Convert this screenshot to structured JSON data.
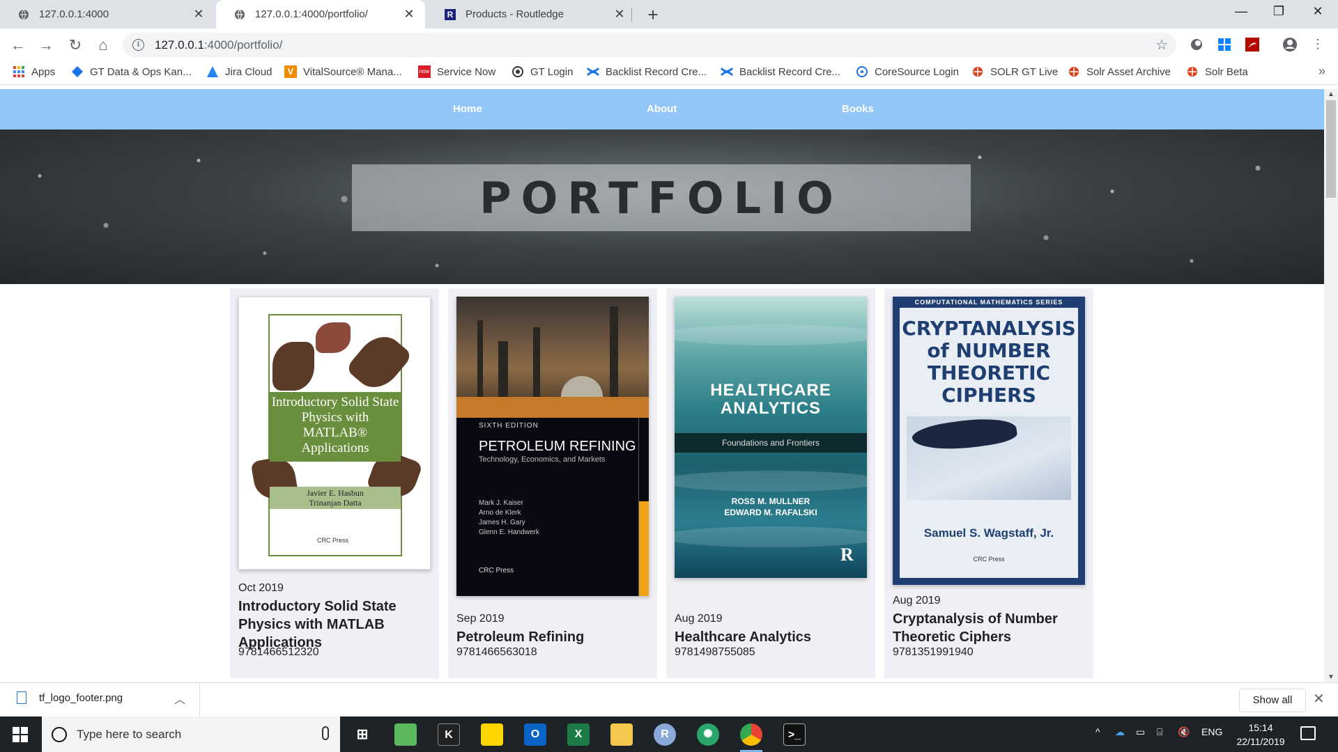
{
  "browser": {
    "tabs": [
      {
        "title": "127.0.0.1:4000",
        "active": false
      },
      {
        "title": "127.0.0.1:4000/portfolio/",
        "active": true
      },
      {
        "title": "Products - Routledge",
        "active": false
      }
    ],
    "url_host": "127.0.0.1",
    "url_path": ":4000/portfolio/",
    "bookmarks": [
      "Apps",
      "GT Data & Ops Kan...",
      "Jira Cloud",
      "VitalSource® Mana...",
      "Service Now",
      "GT Login",
      "Backlist Record Cre...",
      "Backlist Record Cre...",
      "CoreSource Login",
      "SOLR GT Live",
      "Solr Asset Archive",
      "Solr Beta"
    ],
    "bookmark_more": "»",
    "colors": {
      "tabstrip": "#dee1e6",
      "site_nav": "#92c6f7"
    }
  },
  "site": {
    "nav": [
      "Home",
      "About",
      "Books"
    ],
    "hero_title": "PORTFOLIO",
    "books": [
      {
        "date": "Oct 2019",
        "title": "Introductory Solid State Physics with MATLAB Applications",
        "isbn": "9781466512320",
        "cover": {
          "title": "Introductory Solid State Physics with MATLAB® Applications",
          "authors": [
            "Javier E. Hasbun",
            "Trinanjan Datta"
          ],
          "publisher": "CRC Press"
        }
      },
      {
        "date": "Sep 2019",
        "title": "Petroleum Refining",
        "isbn": "9781466563018",
        "cover": {
          "edition": "SIXTH EDITION",
          "title": "PETROLEUM REFINING",
          "subtitle": "Technology, Economics, and Markets",
          "authors": [
            "Mark J. Kaiser",
            "Arno de Klerk",
            "James H. Gary",
            "Glenn E. Handwerk"
          ],
          "publisher": "CRC Press"
        }
      },
      {
        "date": "Aug 2019",
        "title": "Healthcare Analytics",
        "isbn": "9781498755085",
        "cover": {
          "title": "HEALTHCARE ANALYTICS",
          "subtitle": "Foundations and Frontiers",
          "authors": [
            "ROSS M. MULLNER",
            "EDWARD M. RAFALSKI"
          ],
          "logo": "R"
        }
      },
      {
        "date": "Aug 2019",
        "title": "Cryptanalysis of Number Theoretic Ciphers",
        "isbn": "9781351991940",
        "cover": {
          "series": "COMPUTATIONAL MATHEMATICS SERIES",
          "title": "CRYPTANALYSIS of NUMBER THEORETIC CIPHERS",
          "authors": [
            "Samuel S. Wagstaff, Jr."
          ],
          "publisher": "CRC Press"
        }
      }
    ]
  },
  "downloads": {
    "file": "tf_logo_footer.png",
    "show_all": "Show all"
  },
  "taskbar": {
    "search_placeholder": "Type here to search",
    "language": "ENG",
    "time": "15:14",
    "date": "22/11/2019"
  }
}
